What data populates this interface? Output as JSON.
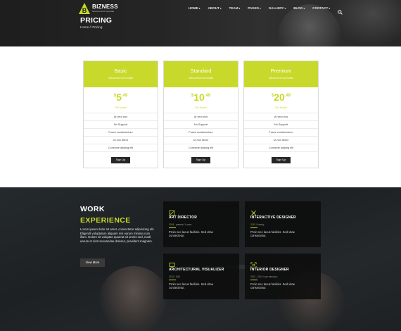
{
  "brand": {
    "name": "BIZNESS",
    "tagline": "business and corporate",
    "accent": "#c8d92b"
  },
  "nav": [
    {
      "label": "HOME",
      "caret": true
    },
    {
      "label": "ABOUT",
      "caret": true
    },
    {
      "label": "TEAM",
      "caret": true
    },
    {
      "label": "PAGES",
      "caret": true
    },
    {
      "label": "GALLERY",
      "caret": true
    },
    {
      "label": "BLOG",
      "caret": true
    },
    {
      "label": "CONTACT",
      "caret": true
    }
  ],
  "header": {
    "title": "PRICING",
    "breadcrumb": "Home // Pricing"
  },
  "pricing": {
    "plans": [
      {
        "name": "Basic",
        "subtitle": "Officia deserunt mollitia",
        "currency": "$",
        "int": "5",
        "dec": ".49",
        "period": "Per Month",
        "features": [
          "At vero eos",
          "No Support",
          "Fusce condimentum",
          "Ut non libero",
          "Consecte adiping elit"
        ],
        "button": "Sign Up"
      },
      {
        "name": "Standard",
        "subtitle": "Officia deserunt mollitia",
        "currency": "$",
        "int": "10",
        "dec": ".49",
        "period": "Per Month",
        "features": [
          "At vero eos",
          "No Support",
          "Fusce condimentum",
          "Ut non libero",
          "Consecte adiping elit"
        ],
        "button": "Sign Up"
      },
      {
        "name": "Premium",
        "subtitle": "Officia deserunt mollitia",
        "currency": "$",
        "int": "20",
        "dec": ".49",
        "period": "Per Month",
        "features": [
          "At vero eos",
          "No Support",
          "Fusce condimentum",
          "Ut non libero",
          "Consecte adiping elit"
        ],
        "button": "Sign Up"
      }
    ]
  },
  "work": {
    "title_line1": "WORK",
    "title_line2": "EXPERIENCE",
    "text": "Lorem ipsum dolor sit amet, consectetur adipisicing elit. Eligendi voluptatum aliquam nisi earum minima cum illum. Dolore sit voluptas quaerat sit omnis sed, modi earum et sint recusandae dolores, provident magnam.",
    "button": "View More",
    "jobs": [
      {
        "icon": "pencil-ruler-icon",
        "title": "ART DIRECTOR",
        "meta": "2018 - present / Lorem",
        "desc": "Proin nec lacus facilisis. Sed vitae consectetur."
      },
      {
        "icon": "pen-tool-icon",
        "title": "INTERACTIVE DESIGNER",
        "meta": "2015 / Ammiy",
        "desc": "Proin nec lacus facilisis. Sed vitae consectetur."
      },
      {
        "icon": "monitor-icon",
        "title": "ARCHITECTURAL VISUALIZER",
        "meta": "2012 / USA",
        "desc": "Proin nec lacus facilisis. Sed vitae consectetur."
      },
      {
        "icon": "expand-icon",
        "title": "INTERIOR DESIGNER",
        "meta": "2010 - 2014 / san francisco",
        "desc": "Proin nec lacus facilisis. Sed vitae consectetur."
      }
    ]
  }
}
